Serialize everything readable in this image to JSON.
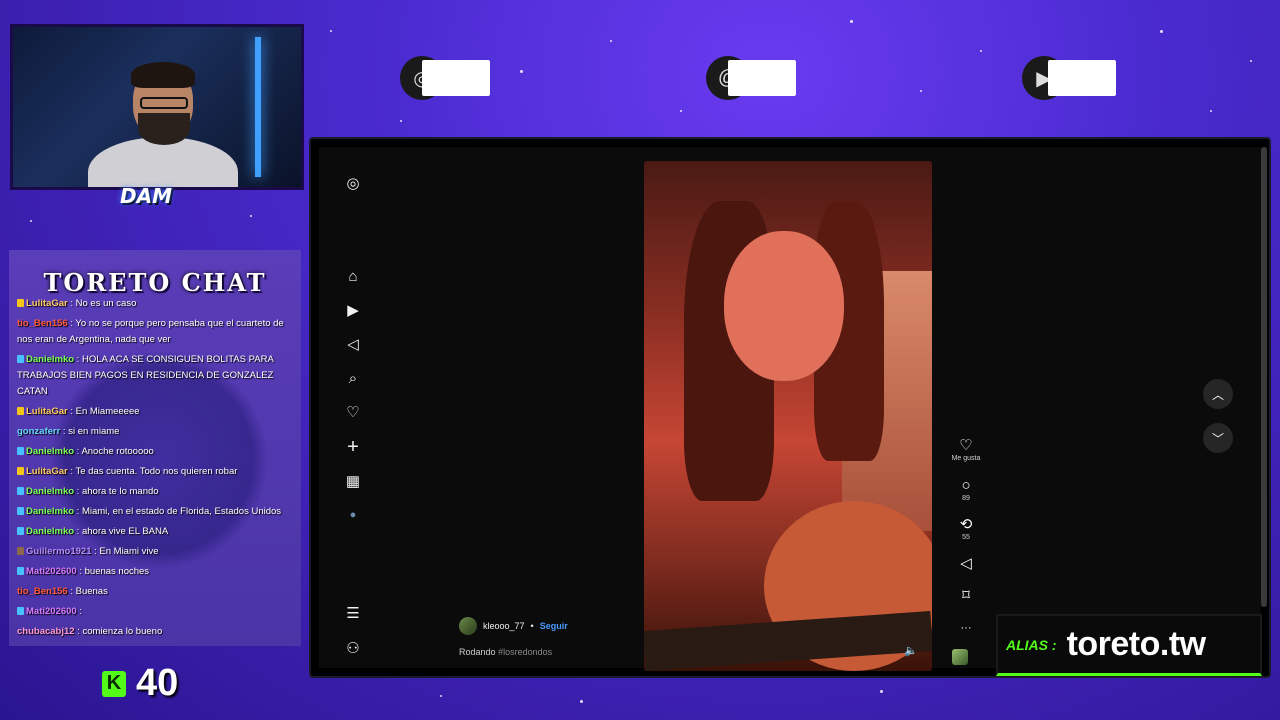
{
  "overlay": {
    "chat_title": "TORETO CHAT",
    "kick_count": "40",
    "kick_icon": "K",
    "alias_label": "ALIAS :",
    "alias_value": "toreto.tw",
    "logo_text": "DAM",
    "accent_green": "#53fc18"
  },
  "chat": {
    "messages": [
      {
        "user": "LulitaGar",
        "text": " : No es un caso",
        "user_color": "#ffcc66",
        "badge_color": "#f5c518"
      },
      {
        "user": "tio_Ben156",
        "text": " : Yo no se porque pero pensaba que el cuarteto de nos eran de Argentina, nada que ver",
        "user_color": "#ff5a3c",
        "badge_color": ""
      },
      {
        "user": "Danielmko",
        "text": " : HOLA ACA SE CONSIGUEN BOLITAS PARA TRABAJOS BIEN PAGOS EN RESIDENCIA DE GONZALEZ CATAN",
        "user_color": "#7dff5a",
        "badge_color": "#4ac0ff"
      },
      {
        "user": "LulitaGar",
        "text": " : En Miameeeee",
        "user_color": "#ffcc66",
        "badge_color": "#f5c518"
      },
      {
        "user": "gonzaferr",
        "text": " : si en miame",
        "user_color": "#6ad6ff",
        "badge_color": ""
      },
      {
        "user": "Danielmko",
        "text": " : Anoche rotooooo",
        "user_color": "#7dff5a",
        "badge_color": "#4ac0ff"
      },
      {
        "user": "LulitaGar",
        "text": " : Te das cuenta. Todo nos quieren robar",
        "user_color": "#ffcc66",
        "badge_color": "#f5c518"
      },
      {
        "user": "Danielmko",
        "text": " : ahora te lo mando",
        "user_color": "#7dff5a",
        "badge_color": "#4ac0ff"
      },
      {
        "user": "Danielmko",
        "text": " : Miami, en el estado de Florida, Estados Unidos",
        "user_color": "#7dff5a",
        "badge_color": "#4ac0ff"
      },
      {
        "user": "Danielmko",
        "text": " : ahora vive EL BANA",
        "user_color": "#7dff5a",
        "badge_color": "#4ac0ff"
      },
      {
        "user": "Guillermo1921",
        "text": " : En Miami vive",
        "user_color": "#b58aff",
        "badge_color": "#8a6a4a"
      },
      {
        "user": "Mati202600",
        "text": " : buenas noches",
        "user_color": "#d77aff",
        "badge_color": "#4ac0ff"
      },
      {
        "user": "tio_Ben156",
        "text": " : Buenas",
        "user_color": "#ff5a3c",
        "badge_color": ""
      },
      {
        "user": "Mati202600",
        "text": " : ",
        "user_color": "#d77aff",
        "badge_color": "#4ac0ff"
      },
      {
        "user": "chubacabj12",
        "text": " : comienza lo bueno",
        "user_color": "#ff9ad6",
        "badge_color": ""
      }
    ]
  },
  "sidebar": {
    "items": [
      {
        "name": "instagram-logo-icon",
        "glyph": "◎"
      },
      {
        "name": "home-icon",
        "glyph": "⌂"
      },
      {
        "name": "reels-icon",
        "glyph": "▶"
      },
      {
        "name": "messages-icon",
        "glyph": "◁"
      },
      {
        "name": "search-icon",
        "glyph": "⌕"
      },
      {
        "name": "notifications-icon",
        "glyph": "♡"
      },
      {
        "name": "create-icon",
        "glyph": "+"
      },
      {
        "name": "dashboard-icon",
        "glyph": "▦"
      },
      {
        "name": "profile-icon",
        "glyph": "●"
      },
      {
        "name": "more-menu-icon",
        "glyph": "☰"
      },
      {
        "name": "also-from-meta-icon",
        "glyph": "⚇"
      }
    ]
  },
  "reel": {
    "author": "kleooo_77",
    "separator": "•",
    "follow_label": "Seguir",
    "caption": "Rodando",
    "hashtag": "#losredondos",
    "like_label": "Me gusta",
    "comments_count": "89",
    "reposts_count": "55",
    "like_glyph": "♡",
    "comment_glyph": "○",
    "repost_glyph": "⟲",
    "share_glyph": "◁",
    "save_glyph": "⌑",
    "more_glyph": "···",
    "volume_glyph": "🔈",
    "prev_glyph": "︿",
    "next_glyph": "﹀"
  }
}
